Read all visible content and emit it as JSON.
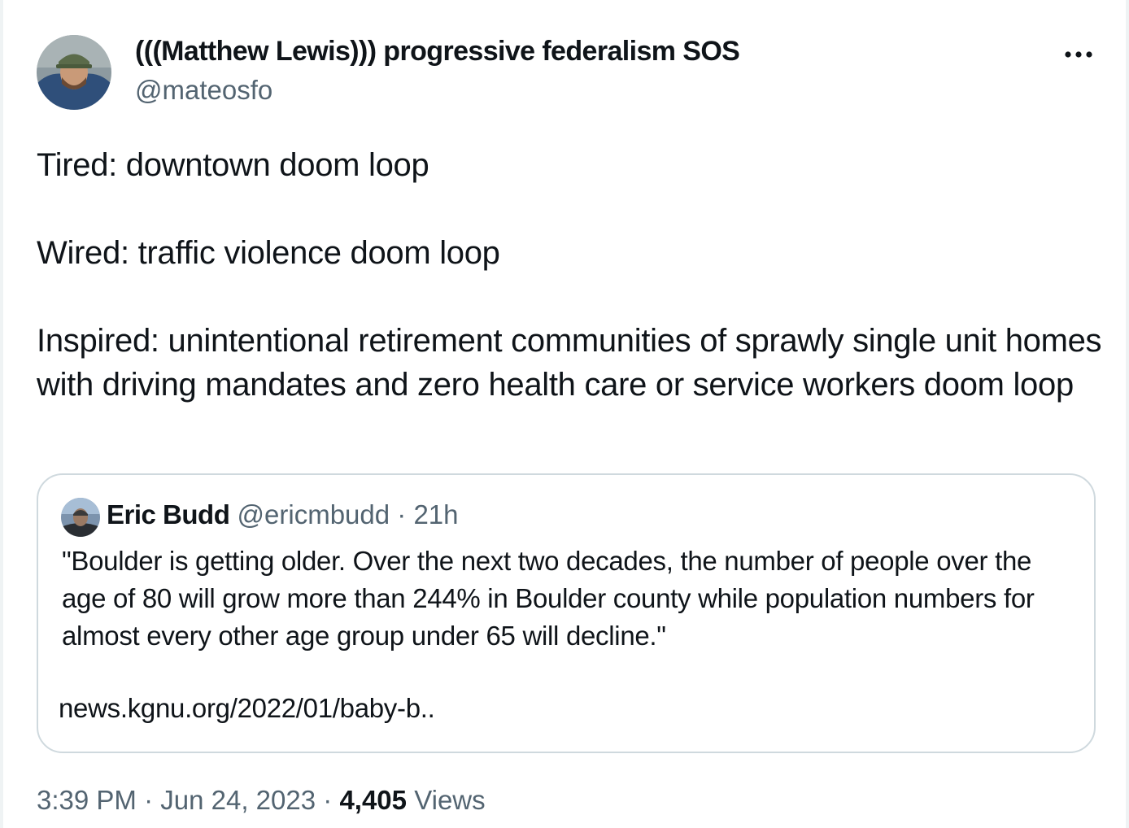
{
  "tweet": {
    "author": {
      "name": "(((Matthew Lewis))) progressive federalism SOS",
      "handle": "@mateosfo"
    },
    "more_icon": "more-horizontal-icon",
    "body": {
      "line1": "Tired: downtown doom loop",
      "line2": "Wired: traffic violence doom loop",
      "line3": "Inspired: unintentional retirement communities of sprawly single unit homes with driving mandates and zero health care or service workers doom loop"
    },
    "quote": {
      "name": "Eric Budd",
      "handle": "@ericmbudd",
      "separator": "·",
      "time": "21h",
      "text": "\"Boulder is getting older. Over the next two decades, the number of people over the age of 80 will grow more than 244% in Boulder county while population numbers for almost every other age group under 65 will decline.\"",
      "link": "news.kgnu.org/2022/01/baby-b.."
    },
    "footer": {
      "time": "3:39 PM",
      "sep1": "·",
      "date": "Jun 24, 2023",
      "sep2": "·",
      "views_count": "4,405",
      "views_label": "Views"
    }
  },
  "colors": {
    "text": "#0f1419",
    "secondary": "#536471",
    "border": "#cfd9de"
  }
}
